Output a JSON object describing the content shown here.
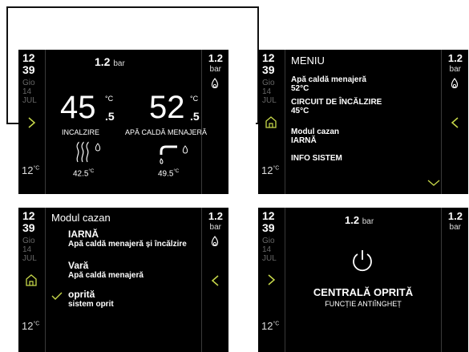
{
  "colors": {
    "accent": "#c8d94a",
    "screen_bg": "#000000",
    "divider": "#3a3a3a"
  },
  "clock": {
    "hour": "12",
    "minute": "39",
    "day": "Gio",
    "date": "14",
    "month": "JUL",
    "temp": "12",
    "temp_unit": "°C"
  },
  "pressure": {
    "value": "1.2",
    "unit": "bar"
  },
  "screen1": {
    "header_pressure": "1.2",
    "header_unit": "bar",
    "heating": {
      "int": "45",
      "dec": ".5",
      "unit": "°C",
      "label": "INCALZIRE",
      "actual": "42.5",
      "actual_unit": "°C",
      "icon": "radiator-heat-icon"
    },
    "dhw": {
      "int": "52",
      "dec": ".5",
      "unit": "°C",
      "label": "APĂ CALDĂ MENAJERĂ",
      "actual": "49.5",
      "actual_unit": "°C",
      "icon": "tap-icon"
    }
  },
  "screen2": {
    "title": "MENIU",
    "items": [
      {
        "label": "Apă caldă menajeră",
        "value": "52°C"
      },
      {
        "label": "CIRCUIT DE ÎNCĂLZIRE",
        "value": "45°C"
      },
      {
        "label": "Modul cazan",
        "value": "IARNĂ"
      },
      {
        "label": "INFO SISTEM",
        "value": ""
      }
    ]
  },
  "screen3": {
    "title": "Modul cazan",
    "options": [
      {
        "label": "IARNĂ",
        "desc": "Apă caldă menajeră și încălzire",
        "selected": false
      },
      {
        "label": "Vară",
        "desc": "Apă caldă menajeră",
        "selected": false
      },
      {
        "label": "oprită",
        "desc": "sistem oprit",
        "selected": true
      }
    ]
  },
  "screen4": {
    "pressure": "1.2",
    "unit": "bar",
    "status": "CENTRALĂ OPRITĂ",
    "sub": "FUNCȚIE ANTIÎNGHEȚ"
  }
}
